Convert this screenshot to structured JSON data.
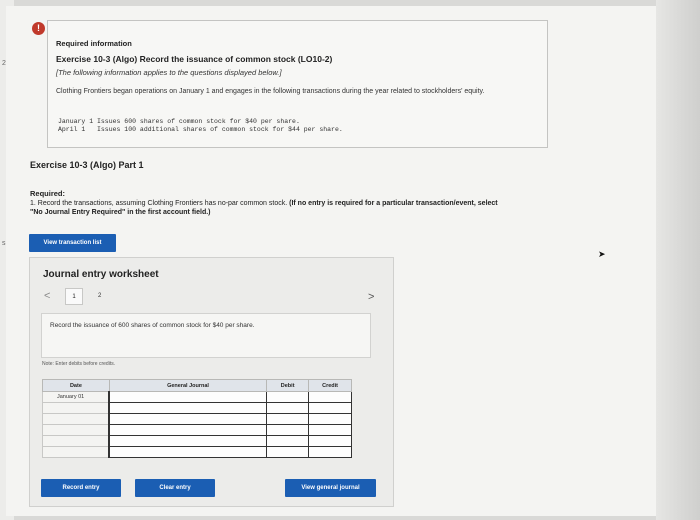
{
  "edge": {
    "number": "2",
    "s": "s"
  },
  "info": {
    "alert_glyph": "!",
    "required_heading": "Required information",
    "exercise_title": "Exercise 10-3 (Algo) Record the issuance of common stock (LO10-2)",
    "applies_note": "[The following information applies to the questions displayed below.]",
    "description": "Clothing Frontiers began operations on January 1 and engages in the following transactions during the year related to stockholders' equity.",
    "transactions": [
      "January 1 Issues 600 shares of common stock for $40 per share.",
      "April 1   Issues 100 additional shares of common stock for $44 per share."
    ]
  },
  "part": {
    "title": "Exercise 10-3 (Algo) Part 1",
    "required_heading": "Required:",
    "required_text": "1. Record the transactions, assuming Clothing Frontiers has no-par common stock.",
    "required_bold": "(If no entry is required for a particular transaction/event, select \"No Journal Entry Required\" in the first account field.)"
  },
  "buttons": {
    "view_transaction_list": "View transaction list",
    "record_entry": "Record entry",
    "clear_entry": "Clear entry",
    "view_general_journal": "View general journal"
  },
  "worksheet": {
    "title": "Journal entry worksheet",
    "pages": [
      "1",
      "2"
    ],
    "current_page": "1",
    "prev_glyph": "<",
    "next_glyph": ">",
    "instruction": "Record the issuance of 600 shares of common stock for $40 per share.",
    "note": "Note: Enter debits before credits.",
    "columns": {
      "date": "Date",
      "journal": "General Journal",
      "debit": "Debit",
      "credit": "Credit"
    },
    "rows": [
      {
        "date": "January 01"
      },
      {
        "date": ""
      },
      {
        "date": ""
      },
      {
        "date": ""
      },
      {
        "date": ""
      },
      {
        "date": ""
      }
    ]
  }
}
